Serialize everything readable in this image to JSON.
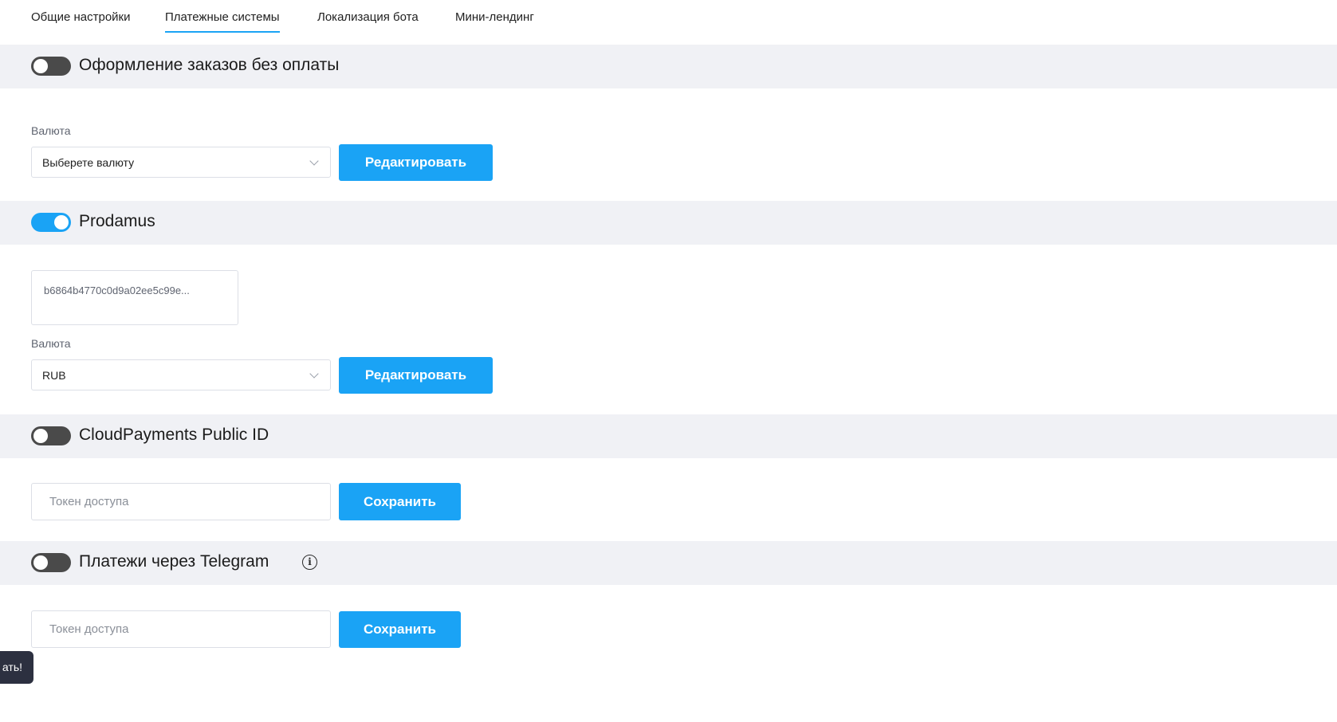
{
  "tabs": [
    {
      "label": "Общие настройки",
      "active": false
    },
    {
      "label": "Платежные системы",
      "active": true
    },
    {
      "label": "Локализация бота",
      "active": false
    },
    {
      "label": "Мини-лендинг",
      "active": false
    }
  ],
  "sections": {
    "no_payment": {
      "title": "Оформление заказов без оплаты",
      "toggle_on": false,
      "currency_label": "Валюта",
      "currency_value": "Выберете валюту",
      "button": "Редактировать"
    },
    "prodamus": {
      "title": "Prodamus",
      "toggle_on": true,
      "key_value": "b6864b4770c0d9a02ee5c99e...",
      "currency_label": "Валюта",
      "currency_value": "RUB",
      "button": "Редактировать"
    },
    "cloudpayments": {
      "title": "CloudPayments Public ID",
      "toggle_on": false,
      "token_placeholder": "Токен доступа",
      "button": "Сохранить"
    },
    "telegram": {
      "title": "Платежи через Telegram",
      "toggle_on": false,
      "info_icon": "info-icon",
      "token_placeholder": "Токен доступа",
      "button": "Сохранить"
    }
  },
  "toast": {
    "text": "ать!"
  },
  "colors": {
    "accent": "#1aa3f5",
    "band": "#f0f1f5",
    "toggle_off": "#4a4a4a",
    "toast_bg": "#2c3040"
  }
}
